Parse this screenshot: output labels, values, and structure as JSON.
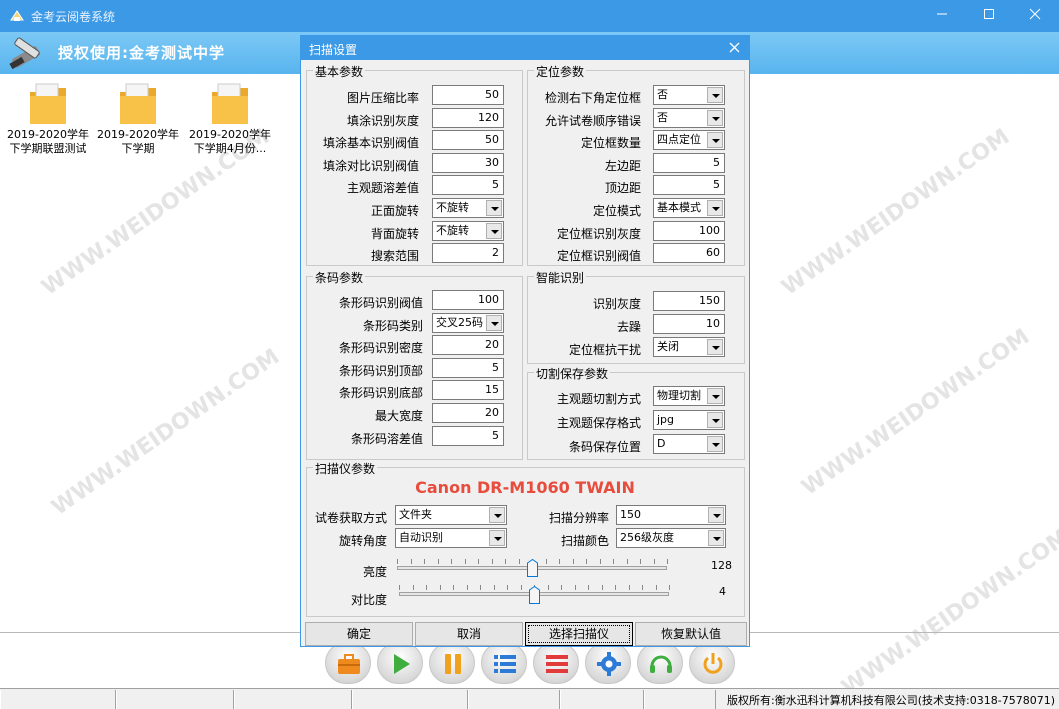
{
  "window": {
    "title": "金考云阅卷系统"
  },
  "header": {
    "auth_text": "授权使用:金考测试中学"
  },
  "folders": [
    {
      "name_line1": "2019-2020学年",
      "name_line2": "下学期联盟测试"
    },
    {
      "name_line1": "2019-2020学年",
      "name_line2": "下学期"
    },
    {
      "name_line1": "2019-2020学年",
      "name_line2": "下学期4月份..."
    }
  ],
  "watermark": "WWW.WEIDOWN.COM",
  "dialog": {
    "title": "扫描设置",
    "basic": {
      "legend": "基本参数",
      "rows": [
        {
          "label": "图片压缩比率",
          "value": "50",
          "kind": "text"
        },
        {
          "label": "填涂识别灰度",
          "value": "120",
          "kind": "text"
        },
        {
          "label": "填涂基本识别阀值",
          "value": "50",
          "kind": "text"
        },
        {
          "label": "填涂对比识别阀值",
          "value": "30",
          "kind": "text"
        },
        {
          "label": "主观题溶差值",
          "value": "5",
          "kind": "text"
        },
        {
          "label": "正面旋转",
          "value": "不旋转",
          "kind": "select"
        },
        {
          "label": "背面旋转",
          "value": "不旋转",
          "kind": "select"
        },
        {
          "label": "搜索范围",
          "value": "2",
          "kind": "text"
        }
      ]
    },
    "position": {
      "legend": "定位参数",
      "rows": [
        {
          "label": "检测右下角定位框",
          "value": "否",
          "kind": "select"
        },
        {
          "label": "允许试卷顺序错误",
          "value": "否",
          "kind": "select"
        },
        {
          "label": "定位框数量",
          "value": "四点定位",
          "kind": "select"
        },
        {
          "label": "左边距",
          "value": "5",
          "kind": "text"
        },
        {
          "label": "顶边距",
          "value": "5",
          "kind": "text"
        },
        {
          "label": "定位模式",
          "value": "基本模式",
          "kind": "select"
        },
        {
          "label": "定位框识别灰度",
          "value": "100",
          "kind": "text"
        },
        {
          "label": "定位框识别阀值",
          "value": "60",
          "kind": "text"
        }
      ]
    },
    "barcode": {
      "legend": "条码参数",
      "rows": [
        {
          "label": "条形码识别阀值",
          "value": "100",
          "kind": "text"
        },
        {
          "label": "条形码类别",
          "value": "交叉25码",
          "kind": "select"
        },
        {
          "label": "条形码识别密度",
          "value": "20",
          "kind": "text"
        },
        {
          "label": "条形码识别顶部",
          "value": "5",
          "kind": "text"
        },
        {
          "label": "条形码识别底部",
          "value": "15",
          "kind": "text"
        },
        {
          "label": "最大宽度",
          "value": "20",
          "kind": "text"
        },
        {
          "label": "条形码溶差值",
          "value": "5",
          "kind": "text"
        }
      ]
    },
    "smart": {
      "legend": "智能识别",
      "rows": [
        {
          "label": "识别灰度",
          "value": "150",
          "kind": "text"
        },
        {
          "label": "去躁",
          "value": "10",
          "kind": "text"
        },
        {
          "label": "定位框抗干扰",
          "value": "关闭",
          "kind": "select"
        }
      ]
    },
    "cut": {
      "legend": "切割保存参数",
      "rows": [
        {
          "label": "主观题切割方式",
          "value": "物理切割",
          "kind": "select"
        },
        {
          "label": "主观题保存格式",
          "value": "jpg",
          "kind": "select"
        },
        {
          "label": "条码保存位置",
          "value": "D",
          "kind": "select"
        }
      ]
    },
    "scanner": {
      "legend": "扫描仪参数",
      "device_name": "Canon DR-M1060 TWAIN",
      "acquire_label": "试卷获取方式",
      "acquire_value": "文件夹",
      "rotate_label": "旋转角度",
      "rotate_value": "自动识别",
      "dpi_label": "扫描分辨率",
      "dpi_value": "150",
      "color_label": "扫描颜色",
      "color_value": "256级灰度",
      "brightness_label": "亮度",
      "brightness_value": "128",
      "brightness_fraction": 0.5,
      "contrast_label": "对比度",
      "contrast_value": "4",
      "contrast_fraction": 0.5
    },
    "buttons": {
      "ok": "确定",
      "cancel": "取消",
      "select_scanner": "选择扫描仪",
      "restore": "恢复默认值"
    }
  },
  "statusbar": {
    "copyright": "版权所有:衡水迅科计算机科技有限公司(技术支持:0318-7578071)"
  },
  "colors": {
    "titlebar": "#3c99e6",
    "header": "#58b4ee",
    "scanner_name": "#e74c3c"
  }
}
